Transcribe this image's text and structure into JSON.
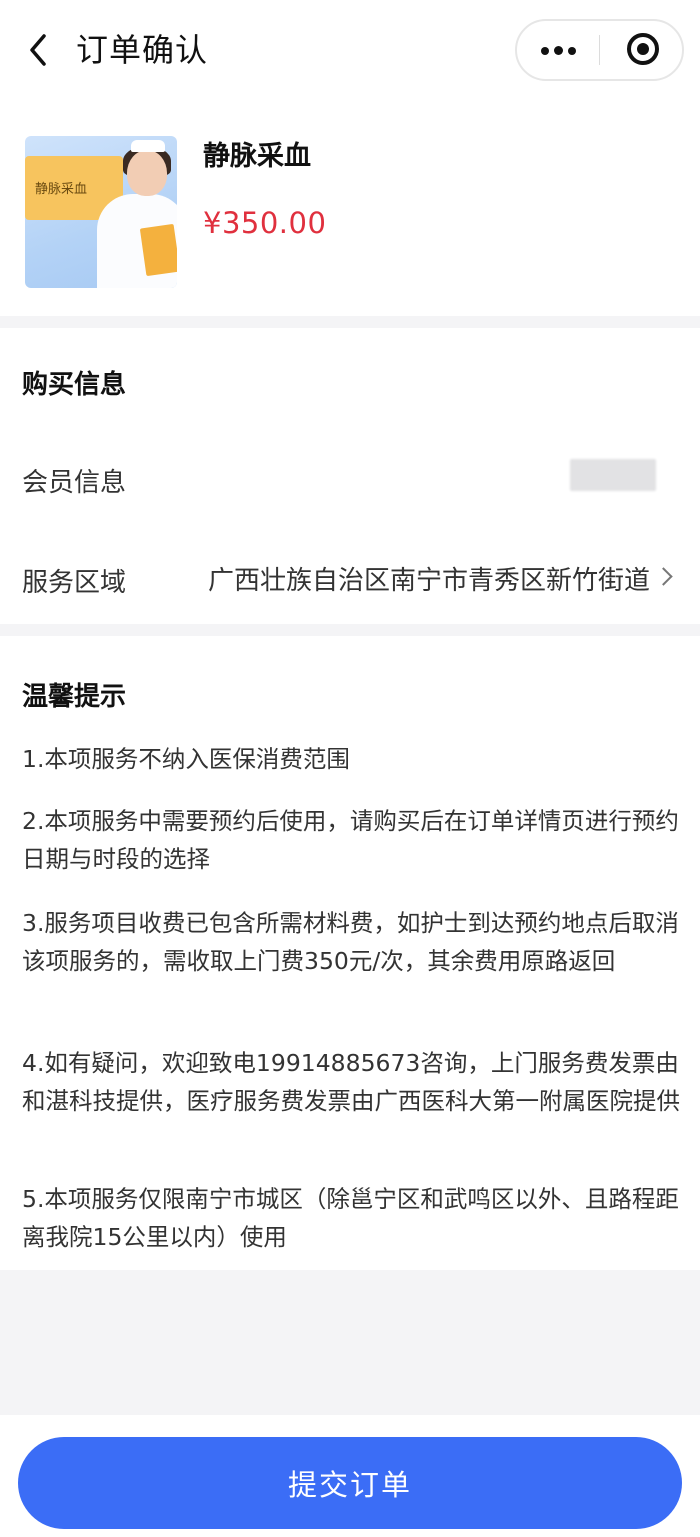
{
  "nav": {
    "title": "订单确认"
  },
  "product": {
    "thumb_text": "静脉采血",
    "name": "静脉采血",
    "price": "¥350.00"
  },
  "purchase": {
    "title": "购买信息",
    "member_label": "会员信息",
    "area_label": "服务区域",
    "area_value": "广西壮族自治区南宁市青秀区新竹街道"
  },
  "tips": {
    "title": "温馨提示",
    "items": [
      "1.本项服务不纳入医保消费范围",
      "2.本项服务中需要预约后使用，请购买后在订单详情页进行预约日期与时段的选择",
      "3.服务项目收费已包含所需材料费，如护士到达预约地点后取消该项服务的，需收取上门费350元/次，其余费用原路返回",
      "4.如有疑问，欢迎致电19914885673咨询，上门服务费发票由和湛科技提供，医疗服务费发票由广西医科大第一附属医院提供",
      "5.本项服务仅限南宁市城区（除邕宁区和武鸣区以外、且路程距离我院15公里以内）使用"
    ]
  },
  "footer": {
    "submit_label": "提交订单"
  },
  "colors": {
    "accent": "#3b6df6",
    "price": "#e0303e"
  },
  "icons": [
    "back-arrow-icon",
    "more-dots-icon",
    "target-circle-icon",
    "chevron-right-icon"
  ]
}
